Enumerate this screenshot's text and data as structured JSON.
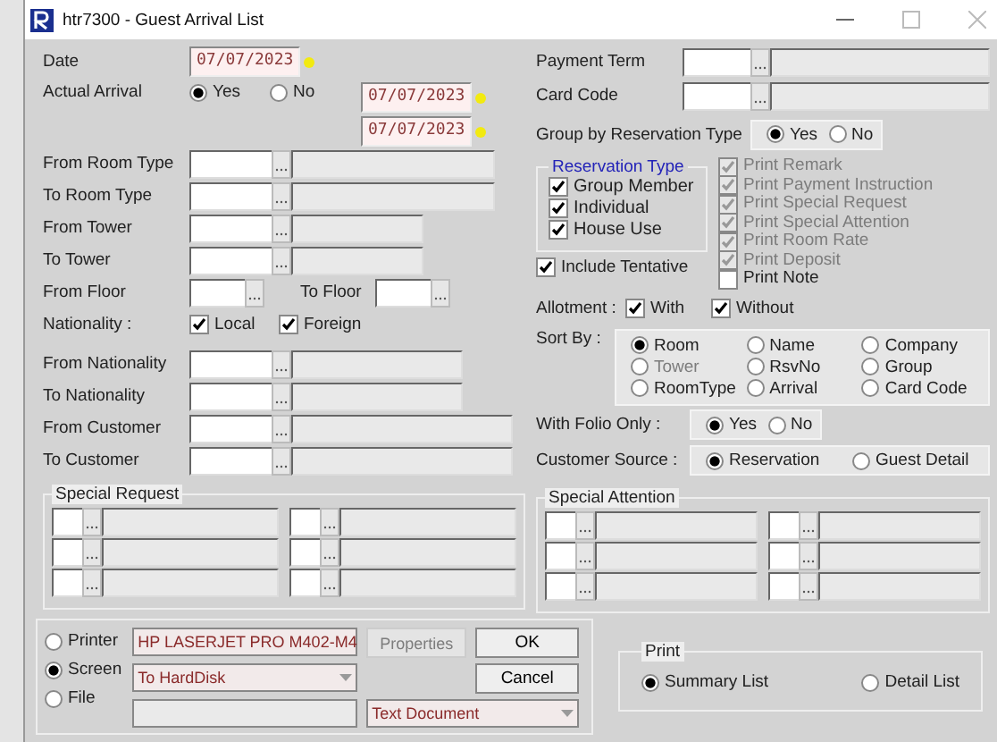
{
  "window": {
    "title": "htr7300 -  Guest Arrival List"
  },
  "date": {
    "label": "Date",
    "value": "07/07/2023"
  },
  "actual_arrival": {
    "label": "Actual Arrival",
    "options": [
      {
        "label": "Yes",
        "selected": true
      },
      {
        "label": "No",
        "selected": false
      }
    ],
    "from": "07/07/2023",
    "to": "07/07/2023"
  },
  "ranges_top": [
    {
      "label": "From Room Type"
    },
    {
      "label": "To Room Type"
    },
    {
      "label": "From Tower"
    },
    {
      "label": "To Tower"
    }
  ],
  "floor": {
    "from_label": "From Floor",
    "to_label": "To Floor"
  },
  "nationality": {
    "label": "Nationality :",
    "options": [
      {
        "label": "Local",
        "checked": true
      },
      {
        "label": "Foreign",
        "checked": true
      }
    ]
  },
  "ranges_bottom": [
    {
      "label": "From Nationality"
    },
    {
      "label": "To Nationality"
    },
    {
      "label": "From Customer"
    },
    {
      "label": "To Customer"
    }
  ],
  "special_request": {
    "title": "Special Request"
  },
  "payment_term": {
    "label": "Payment Term"
  },
  "card_code": {
    "label": "Card Code"
  },
  "group_by": {
    "label": "Group by Reservation Type",
    "options": [
      {
        "label": "Yes",
        "selected": true
      },
      {
        "label": "No",
        "selected": false
      }
    ]
  },
  "reservation_type": {
    "title": "Reservation Type",
    "items": [
      {
        "label": "Group Member",
        "checked": true
      },
      {
        "label": "Individual",
        "checked": true
      },
      {
        "label": "House Use",
        "checked": true
      }
    ]
  },
  "print_options": [
    {
      "label": "Print Remark",
      "checked": true,
      "disabled": true
    },
    {
      "label": "Print Payment Instruction",
      "checked": true,
      "disabled": true
    },
    {
      "label": "Print Special Request",
      "checked": true,
      "disabled": true
    },
    {
      "label": "Print Special Attention",
      "checked": true,
      "disabled": true
    },
    {
      "label": "Print Room Rate",
      "checked": true,
      "disabled": true
    },
    {
      "label": "Print Deposit",
      "checked": true,
      "disabled": true
    },
    {
      "label": "Print Note",
      "checked": false,
      "disabled": false
    }
  ],
  "include_tentative": {
    "label": "Include Tentative",
    "checked": true
  },
  "allotment": {
    "label": "Allotment :",
    "options": [
      {
        "label": "With",
        "checked": true
      },
      {
        "label": "Without",
        "checked": true
      }
    ]
  },
  "sort_by": {
    "label": "Sort By :",
    "options": [
      {
        "label": "Room",
        "selected": true,
        "disabled": false
      },
      {
        "label": "Name",
        "selected": false,
        "disabled": false
      },
      {
        "label": "Company",
        "selected": false,
        "disabled": false
      },
      {
        "label": "Tower",
        "selected": false,
        "disabled": true
      },
      {
        "label": "RsvNo",
        "selected": false,
        "disabled": false
      },
      {
        "label": "Group",
        "selected": false,
        "disabled": false
      },
      {
        "label": "RoomType",
        "selected": false,
        "disabled": false
      },
      {
        "label": "Arrival",
        "selected": false,
        "disabled": false
      },
      {
        "label": "Card Code",
        "selected": false,
        "disabled": false
      }
    ]
  },
  "with_folio": {
    "label": "With Folio Only :",
    "options": [
      {
        "label": "Yes",
        "selected": true
      },
      {
        "label": "No",
        "selected": false
      }
    ]
  },
  "customer_source": {
    "label": "Customer Source :",
    "options": [
      {
        "label": "Reservation",
        "selected": true
      },
      {
        "label": "Guest Detail",
        "selected": false
      }
    ]
  },
  "special_attention": {
    "title": "Special Attention"
  },
  "output": {
    "options": [
      {
        "label": "Printer",
        "selected": false
      },
      {
        "label": "Screen",
        "selected": true
      },
      {
        "label": "File",
        "selected": false
      }
    ],
    "printer_name": "HP LASERJET PRO M402-M4",
    "properties_button": "Properties",
    "screen_target": "To HardDisk",
    "file_type": "Text Document"
  },
  "buttons": [
    "OK",
    "Cancel"
  ],
  "print": {
    "title": "Print",
    "options": [
      {
        "label": "Summary List",
        "selected": true
      },
      {
        "label": "Detail List",
        "selected": false
      }
    ]
  }
}
